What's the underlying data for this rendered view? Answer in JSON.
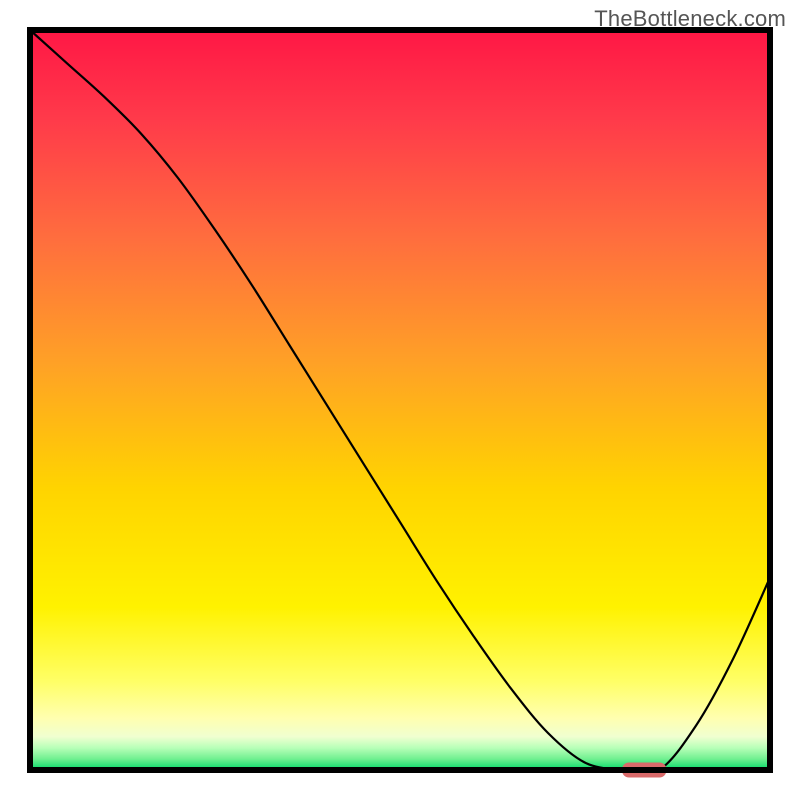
{
  "watermark": "TheBottleneck.com",
  "chart_data": {
    "type": "line",
    "title": "",
    "xlabel": "",
    "ylabel": "",
    "xlim": [
      0,
      100
    ],
    "ylim": [
      0,
      100
    ],
    "x": [
      0,
      5,
      10,
      15,
      20,
      25,
      30,
      35,
      40,
      45,
      50,
      55,
      60,
      65,
      70,
      75,
      80,
      85,
      90,
      95,
      100
    ],
    "values": [
      100,
      95.5,
      91,
      86,
      80,
      73,
      65.5,
      57.5,
      49.5,
      41.5,
      33.5,
      25.5,
      18,
      11,
      5,
      1,
      0,
      0,
      6,
      15,
      26
    ],
    "marker": {
      "x_range": [
        80,
        86
      ],
      "y": 0
    },
    "background_gradient": {
      "top": "#ff1744",
      "mid1": "#ff8a00",
      "mid2": "#ffee00",
      "mid3": "#ffff8d",
      "bottom": "#00e676"
    },
    "frame_color": "#000000",
    "curve_color": "#000000",
    "marker_color": "#d96a6a"
  }
}
